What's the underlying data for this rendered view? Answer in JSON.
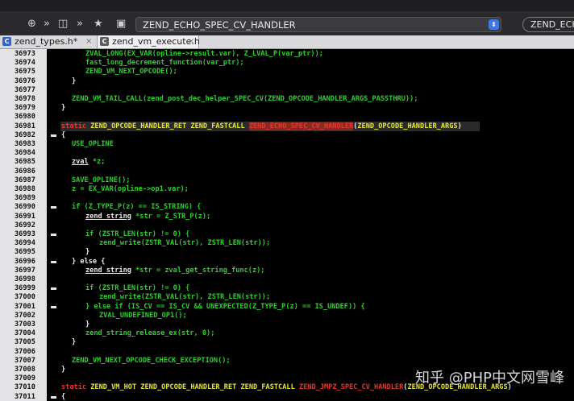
{
  "toolbar": {
    "icons": [
      "globe-icon",
      "forward-icon",
      "layout-icon",
      "forward-icon",
      "star-icon",
      "doc-icon"
    ],
    "function_select_value": "ZEND_ECHO_SPEC_CV_HANDLER",
    "right_field_value": "ZEND_ECH"
  },
  "tabs": [
    {
      "label": "zend_types.h*",
      "icon": "c-header-icon",
      "active": false
    },
    {
      "label": "zend_vm_execute.h",
      "icon": "c-source-icon",
      "active": true
    }
  ],
  "editor": {
    "line_numbers": [
      "36973",
      "36974",
      "36975",
      "36976",
      "36977",
      "36978",
      "36979",
      "36980",
      "36981",
      "36982",
      "36983",
      "36984",
      "36985",
      "36986",
      "36987",
      "36988",
      "36989",
      "36990",
      "36991",
      "36992",
      "36993",
      "36994",
      "36995",
      "36996",
      "36997",
      "36998",
      "36999",
      "37000",
      "37001",
      "37002",
      "37003",
      "37004",
      "37005",
      "37006",
      "37007",
      "37008",
      "37009",
      "37010",
      "37011"
    ],
    "code": [
      "ZVAL_LONG(EX_VAR(opline->result.var), Z_LVAL_P(var_ptr));",
      "fast_long_decrement_function(var_ptr);",
      "ZEND_VM_NEXT_OPCODE();",
      "}",
      "",
      "ZEND_VM_TAIL_CALL(zend_post_dec_helper_SPEC_CV(ZEND_OPCODE_HANDLER_ARGS_PASSTHRU));",
      "}",
      "",
      [
        "static",
        " ZEND_OPCODE_HANDLER_RET ZEND_FASTCALL ",
        "ZEND_ECHO_SPEC_CV_HANDLER",
        "(",
        "ZEND_OPCODE_HANDLER_ARGS",
        ")"
      ],
      "{",
      "USE_OPLINE",
      "",
      [
        "zval",
        " *z;"
      ],
      "",
      "SAVE_OPLINE();",
      "z = EX_VAR(opline->op1.var);",
      "",
      "if (Z_TYPE_P(z) == IS_STRING) {",
      [
        "zend_string",
        " *str = Z_STR_P(z);"
      ],
      "",
      "if (ZSTR_LEN(str) != 0) {",
      "zend_write(ZSTR_VAL(str), ZSTR_LEN(str));",
      "}",
      "} else {",
      [
        "zend_string",
        " *str = zval_get_string_func(z);"
      ],
      "",
      "if (ZSTR_LEN(str) != 0) {",
      "zend_write(ZSTR_VAL(str), ZSTR_LEN(str));",
      "} else if (IS_CV == IS_CV && UNEXPECTED(Z_TYPE_P(z) == IS_UNDEF)) {",
      "ZVAL_UNDEFINED_OP1();",
      "}",
      "zend_string_release_ex(str, 0);",
      "}",
      "",
      "ZEND_VM_NEXT_OPCODE_CHECK_EXCEPTION();",
      "}",
      "",
      [
        "static",
        " ZEND_VM_HOT ZEND_OPCODE_HANDLER_RET ZEND_FASTCALL ",
        "ZEND_JMPZ_SPEC_CV_HANDLER",
        "(",
        "ZEND_OPCODE_HANDLER_ARGS",
        ")"
      ],
      "{"
    ]
  },
  "watermark": "知乎 @PHP中文网雪峰",
  "colors": {
    "keyword": "#e8362c",
    "macro": "#2fcf2f",
    "brace": "#ededed",
    "type": "#e6e633",
    "selection": "#8a2a22"
  }
}
